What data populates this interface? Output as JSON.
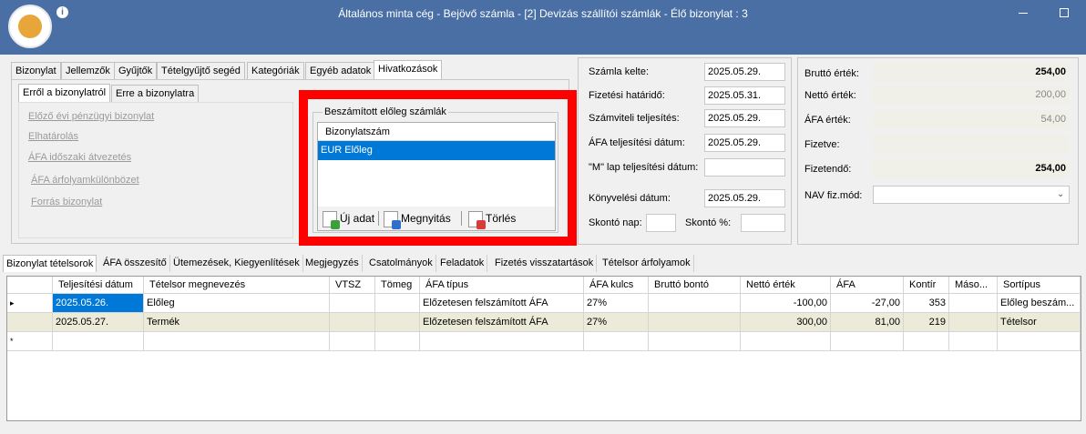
{
  "window": {
    "title": "Általános minta cég - Bejövő számla -  [2] Devizás szállítói számlák - Élő bizonylat : 3",
    "info_glyph": "i"
  },
  "top_tabs": [
    "Bizonylat",
    "Jellemzők",
    "Gyűjtők",
    "Tételgyűjtő segéd",
    "Kategóriák",
    "Egyéb adatok",
    "Hivatkozások"
  ],
  "sub_tabs": [
    "Erről a bizonylatról",
    "Erre a bizonylatra"
  ],
  "links": [
    "Előző évi pénzügyi bizonylat",
    "Elhatárolás",
    "ÁFA időszaki átvezetés",
    "ÁFA árfolyamkülönbözet",
    "Forrás bizonylat"
  ],
  "advance_group": {
    "title": "Beszámított előleg számlák",
    "header": "Bizonylatszám",
    "selected_item": "EUR Előleg",
    "buttons": {
      "new": "Új adat",
      "open": "Megnyitás",
      "delete": "Törlés"
    }
  },
  "dates": {
    "szamla_kelte": {
      "label": "Számla kelte:",
      "value": "2025.05.29."
    },
    "fizetesi_hatarido": {
      "label": "Fizetési határidő:",
      "value": "2025.05.31."
    },
    "szamviteli": {
      "label": "Számviteli teljesítés:",
      "value": "2025.05.29."
    },
    "afa_teljesitesi": {
      "label": "ÁFA teljesítési dátum:",
      "value": "2025.05.29."
    },
    "m_lap": {
      "label": "\"M\" lap teljesítési dátum:",
      "value": ""
    },
    "konyvelesi": {
      "label": "Könyvelési dátum:",
      "value": "2025.05.29."
    },
    "skonto_nap": {
      "label": "Skontó nap:",
      "value": ""
    },
    "skonto_pct": {
      "label": "Skontó %:",
      "value": ""
    }
  },
  "totals": {
    "brutto": {
      "label": "Bruttó érték:",
      "value": "254,00"
    },
    "netto": {
      "label": "Nettó érték:",
      "value": "200,00"
    },
    "afa": {
      "label": "ÁFA érték:",
      "value": "54,00"
    },
    "fizetve": {
      "label": "Fizetve:",
      "value": ""
    },
    "fizetendo": {
      "label": "Fizetendő:",
      "value": "254,00"
    },
    "nav": {
      "label": "NAV fiz.mód:",
      "value": ""
    }
  },
  "bottom_tabs": [
    "Bizonylat tételsorok",
    "ÁFA összesítő",
    "Ütemezések, Kiegyenlítések",
    "Megjegyzés",
    "Csatolmányok",
    "Feladatok",
    "Fizetés visszatartások",
    "Tételsor árfolyamok"
  ],
  "grid": {
    "columns": [
      "Teljesítési dátum",
      "Tételsor megnevezés",
      "VTSZ",
      "Tömeg",
      "ÁFA típus",
      "ÁFA kulcs",
      "Bruttó bontó",
      "Nettó érték",
      "ÁFA",
      "Kontír",
      "Máso...",
      "Sortípus"
    ],
    "rows": [
      [
        "2025.05.26.",
        "Előleg",
        "",
        "",
        "Előzetesen felszámított ÁFA",
        "27%",
        "",
        "-100,00",
        "-27,00",
        "353",
        "",
        "Előleg beszám..."
      ],
      [
        "2025.05.27.",
        "Termék",
        "",
        "",
        "Előzetesen felszámított ÁFA",
        "27%",
        "",
        "300,00",
        "81,00",
        "219",
        "",
        "Tételsor"
      ]
    ],
    "row_indicators": [
      "▸",
      "",
      "*"
    ]
  }
}
